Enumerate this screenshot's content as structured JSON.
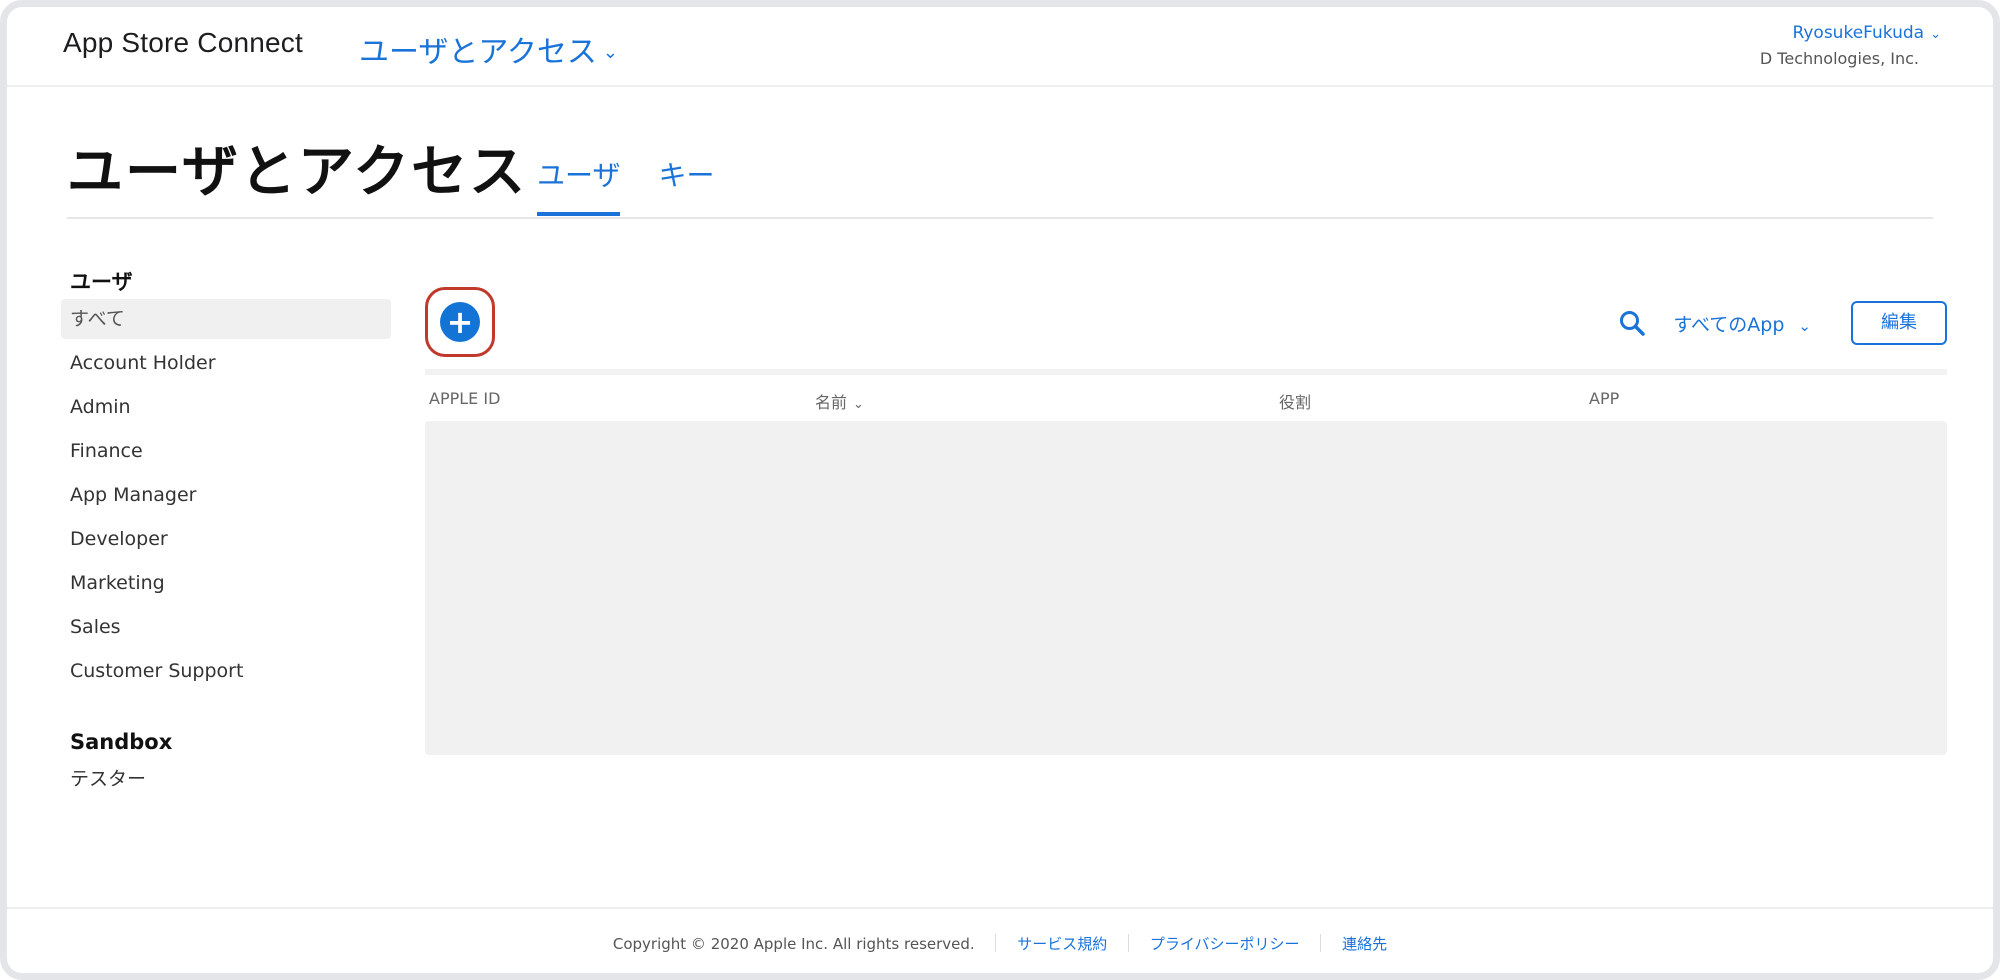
{
  "header": {
    "brand": "App Store Connect",
    "section_menu": "ユーザとアクセス",
    "user_name": "RyosukeFukuda",
    "org_name": "D Technologies, Inc."
  },
  "page": {
    "title": "ユーザとアクセス",
    "tabs": [
      {
        "label": "ユーザ",
        "active": true
      },
      {
        "label": "キー",
        "active": false
      }
    ]
  },
  "sidebar": {
    "groups": [
      {
        "title": "ユーザ",
        "items": [
          {
            "label": "すべて",
            "active": true
          },
          {
            "label": "Account Holder"
          },
          {
            "label": "Admin"
          },
          {
            "label": "Finance"
          },
          {
            "label": "App Manager"
          },
          {
            "label": "Developer"
          },
          {
            "label": "Marketing"
          },
          {
            "label": "Sales"
          },
          {
            "label": "Customer Support"
          }
        ]
      },
      {
        "title": "Sandbox",
        "items": [
          {
            "label": "テスター"
          }
        ]
      }
    ]
  },
  "toolbar": {
    "add_icon": "plus-circle-icon",
    "search_icon": "search-icon",
    "app_filter": "すべてのApp",
    "edit_label": "編集"
  },
  "table": {
    "columns": [
      "APPLE ID",
      "名前",
      "役割",
      "APP"
    ],
    "rows": []
  },
  "footer": {
    "copyright": "Copyright © 2020 Apple Inc. All rights reserved.",
    "links": [
      "サービス規約",
      "プライバシーポリシー",
      "連絡先"
    ]
  },
  "colors": {
    "accent": "#1a73d9",
    "highlight_border": "#c0392b"
  }
}
